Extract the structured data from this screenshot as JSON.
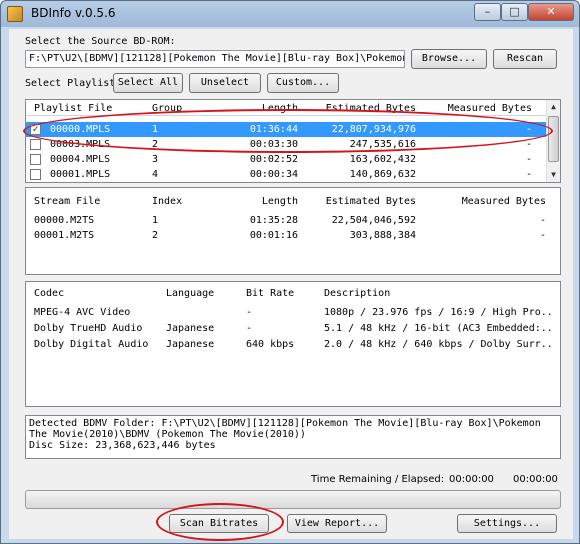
{
  "window": {
    "title": "BDInfo v.0.5.6",
    "controls": {
      "minimize": "–",
      "maximize": "□",
      "close": "✕"
    }
  },
  "source": {
    "label": "Select the Source BD-ROM:",
    "path": "F:\\PT\\U2\\[BDMV][121128][Pokemon The Movie][Blu-ray Box]\\Pokemon T",
    "browse_label": "Browse...",
    "rescan_label": "Rescan"
  },
  "playlist_select": {
    "label": "Select Playlist",
    "select_all_label": "Select All",
    "unselect_label": "Unselect",
    "custom_label": "Custom..."
  },
  "playlists": {
    "headers": [
      "Playlist File",
      "Group",
      "Length",
      "Estimated Bytes",
      "Measured Bytes"
    ],
    "rows": [
      {
        "checked": true,
        "file": "00000.MPLS",
        "group": "1",
        "length": "01:36:44",
        "est": "22,807,934,976",
        "measured": "-",
        "selected": true
      },
      {
        "checked": false,
        "file": "00003.MPLS",
        "group": "2",
        "length": "00:03:30",
        "est": "247,535,616",
        "measured": "-",
        "selected": false
      },
      {
        "checked": false,
        "file": "00004.MPLS",
        "group": "3",
        "length": "00:02:52",
        "est": "163,602,432",
        "measured": "-",
        "selected": false
      },
      {
        "checked": false,
        "file": "00001.MPLS",
        "group": "4",
        "length": "00:00:34",
        "est": "140,869,632",
        "measured": "-",
        "selected": false
      }
    ]
  },
  "streams": {
    "headers": [
      "Stream File",
      "Index",
      "Length",
      "Estimated Bytes",
      "Measured Bytes"
    ],
    "rows": [
      {
        "file": "00000.M2TS",
        "index": "1",
        "length": "01:35:28",
        "est": "22,504,046,592",
        "measured": "-"
      },
      {
        "file": "00001.M2TS",
        "index": "2",
        "length": "00:01:16",
        "est": "303,888,384",
        "measured": "-"
      }
    ]
  },
  "codecs": {
    "headers": [
      "Codec",
      "Language",
      "Bit Rate",
      "Description"
    ],
    "rows": [
      {
        "codec": "MPEG-4 AVC Video",
        "language": "",
        "bitrate": "-",
        "description": "1080p / 23.976 fps / 16:9 / High Pro..."
      },
      {
        "codec": "Dolby TrueHD Audio",
        "language": "Japanese",
        "bitrate": "-",
        "description": "5.1 / 48 kHz / 16-bit (AC3 Embedded:..."
      },
      {
        "codec": "Dolby Digital Audio",
        "language": "Japanese",
        "bitrate": "640 kbps",
        "description": "2.0 / 48 kHz / 640 kbps / Dolby Surr..."
      }
    ]
  },
  "info_text": "Detected BDMV Folder: F:\\PT\\U2\\[BDMV][121128][Pokemon The Movie][Blu-ray Box]\\Pokemon\nThe Movie(2010)\\BDMV (Pokemon The Movie(2010))\nDisc Size: 23,368,623,446 bytes",
  "status": {
    "time_label": "Time Remaining / Elapsed:",
    "remaining": "00:00:00",
    "elapsed": "00:00:00",
    "progress": 0
  },
  "footer": {
    "scan_label": "Scan Bitrates",
    "report_label": "View Report...",
    "settings_label": "Settings..."
  },
  "colors": {
    "selection": "#3399ff",
    "annotation": "#d4141c"
  }
}
